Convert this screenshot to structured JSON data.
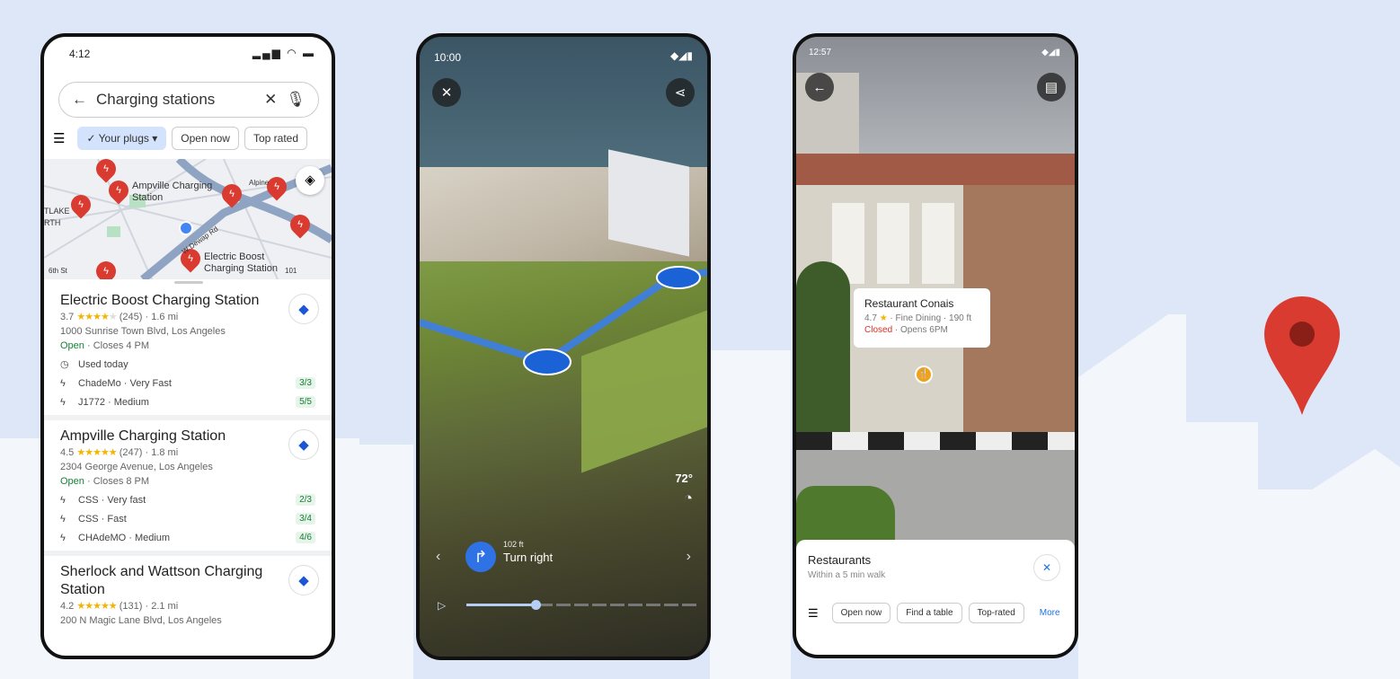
{
  "colors": {
    "background": "#dde7f8",
    "accent": "#1a73e8",
    "pin": "#d93b30",
    "open": "#188038",
    "closed": "#d93025"
  },
  "phone1": {
    "time": "4:12",
    "search": {
      "value": "Charging stations",
      "back_icon": "arrow-left-icon",
      "clear_icon": "close-icon",
      "mic_icon": "mic-icon"
    },
    "filters": {
      "settings_icon": "tune-icon",
      "chips": [
        "Your plugs",
        "Open now",
        "Top rated"
      ]
    },
    "map": {
      "labels": [
        "Ampville Charging Station",
        "Electric Boost Charging Station",
        "TLAKE RTH",
        "6th St",
        "W Dewap Rd",
        "Alpine",
        "101"
      ]
    },
    "results": [
      {
        "name": "Electric Boost Charging Station",
        "rating": "3.7",
        "stars": 3.5,
        "reviews": "(245)",
        "distance": "1.6 mi",
        "address": "1000 Sunrise Town Blvd, Los Angeles",
        "open": "Open",
        "hours": "Closes 4 PM",
        "used": "Used today",
        "plugs": [
          {
            "type": "ChadeMo · Very Fast",
            "avail": "3/3"
          },
          {
            "type": "J1772 · Medium",
            "avail": "5/5"
          }
        ]
      },
      {
        "name": "Ampville Charging Station",
        "rating": "4.5",
        "stars": 4.5,
        "reviews": "(247)",
        "distance": "1.8 mi",
        "address": "2304 George Avenue, Los Angeles",
        "open": "Open",
        "hours": "Closes 8 PM",
        "plugs": [
          {
            "type": "CSS · Very fast",
            "avail": "2/3"
          },
          {
            "type": "CSS · Fast",
            "avail": "3/4"
          },
          {
            "type": "CHAdeMO · Medium",
            "avail": "4/6"
          }
        ]
      },
      {
        "name": "Sherlock and Wattson Charging Station",
        "rating": "4.2",
        "stars": 4.5,
        "reviews": "(131)",
        "distance": "2.1 mi",
        "address": "200 N Magic Lane Blvd, Los Angeles"
      }
    ]
  },
  "phone2": {
    "time": "10:00",
    "close_icon": "close-icon",
    "share_icon": "share-icon",
    "temperature": "72°",
    "time_icon": "clock-icon",
    "instruction": {
      "distance": "102 ft",
      "text": "Turn right",
      "icon": "turn-right-icon"
    },
    "progress": 0.3
  },
  "phone3": {
    "time": "12:57",
    "back_icon": "arrow-left-icon",
    "feedback_icon": "feedback-icon",
    "place": {
      "name": "Restaurant Conais",
      "rating": "4.7",
      "category": "Fine Dining",
      "distance": "190 ft",
      "status": "Closed",
      "hours": "Opens 6PM"
    },
    "sheet": {
      "title": "Restaurants",
      "subtitle": "Within a 5 min walk",
      "chips": [
        "Open now",
        "Find a table",
        "Top-rated"
      ],
      "more": "More"
    }
  }
}
